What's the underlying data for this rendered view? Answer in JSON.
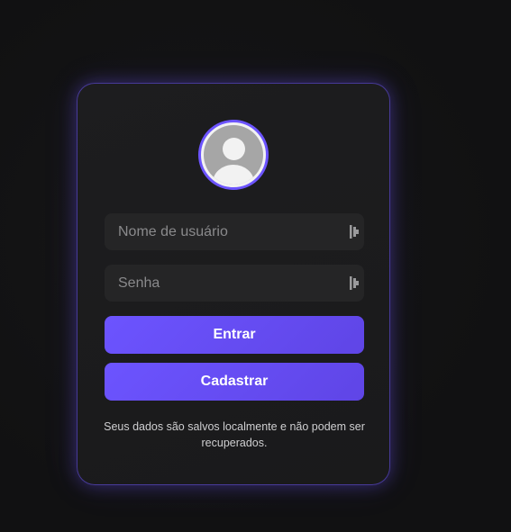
{
  "login": {
    "username_placeholder": "Nome de usuário",
    "username_value": "",
    "password_placeholder": "Senha",
    "password_value": "",
    "login_button": "Entrar",
    "register_button": "Cadastrar",
    "note": "Seus dados são salvos localmente e não podem ser recuperados."
  },
  "icons": {
    "avatar": "user-avatar-icon",
    "field_icon": "password-manager-key-icon"
  },
  "colors": {
    "accent": "#6c54ff",
    "background": "#111112",
    "card": "#1c1c1e",
    "input": "#252526"
  }
}
